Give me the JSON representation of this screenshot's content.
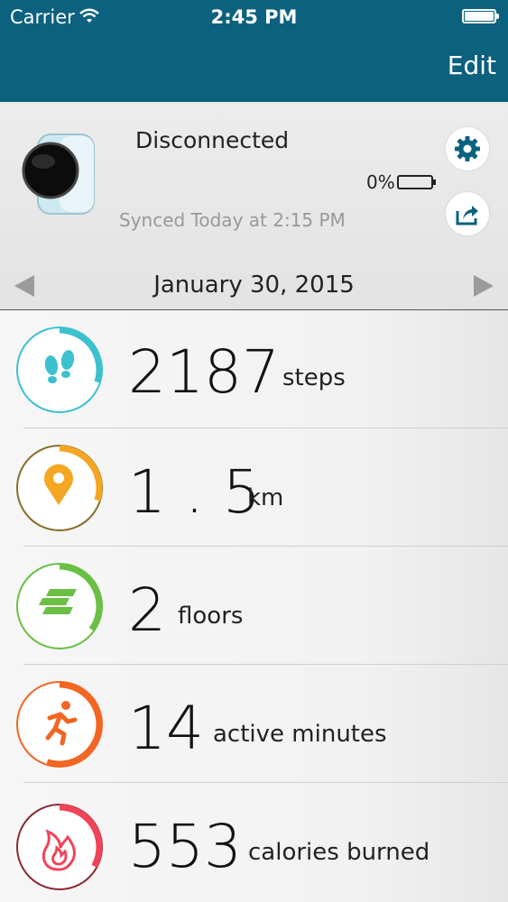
{
  "status_bar": {
    "carrier": "Carrier",
    "time": "2:45 PM"
  },
  "nav": {
    "edit_label": "Edit"
  },
  "device": {
    "connection_status": "Disconnected",
    "battery_percent": "0%",
    "synced_text": "Synced Today at 2:15 PM"
  },
  "date_nav": {
    "date": "January 30, 2015"
  },
  "stats": [
    {
      "value": "2187",
      "unit": "steps",
      "icon": "footsteps-icon",
      "color": "#3cc1cf",
      "progress": 0.3
    },
    {
      "value": "1 . 5",
      "unit": "km",
      "icon": "location-pin-icon",
      "color": "#f5a623",
      "progress": 0.3
    },
    {
      "value": "2",
      "unit": "floors",
      "icon": "stairs-icon",
      "color": "#6abf44",
      "progress": 0.35
    },
    {
      "value": "14",
      "unit": "active minutes",
      "icon": "running-person-icon",
      "color": "#f26522",
      "progress": 0.55
    },
    {
      "value": "553",
      "unit": "calories burned",
      "icon": "flame-icon",
      "color": "#f0445a",
      "progress": 0.33
    }
  ],
  "colors": {
    "header": "#0b617e",
    "accent": "#0b617e"
  }
}
